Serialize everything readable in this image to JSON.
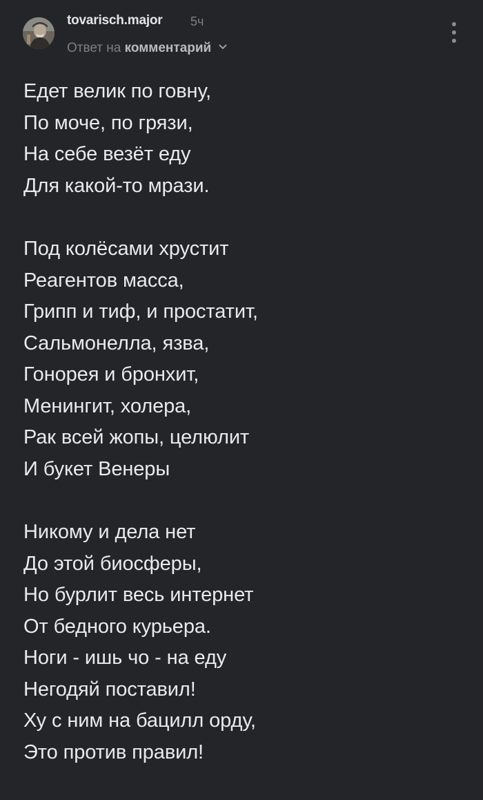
{
  "comment": {
    "author": "tovarisch.major",
    "time": "5ч",
    "reply_prefix": "Ответ на",
    "reply_link": "комментарий",
    "reply_icon": "chevron-down-icon",
    "menu_icon": "more-vertical-icon",
    "avatar_icon": "user-avatar"
  },
  "poem": {
    "stanzas": [
      {
        "lines": [
          "Едет велик по говну,",
          "По моче, по грязи,",
          "На себе везёт еду",
          "Для какой-то мрази."
        ]
      },
      {
        "lines": [
          "Под колёсами хрустит",
          "Реагентов масса,",
          "Грипп и тиф, и простатит,",
          "Сальмонелла, язва,",
          "Гонорея и бронхит,",
          "Менингит, холера,",
          "Рак всей жопы, целюлит",
          "И букет Венеры"
        ]
      },
      {
        "lines": [
          "Никому и дела нет",
          "До этой биосферы,",
          "Но бурлит весь интернет",
          "От бедного курьера.",
          "Ноги - ишь чо - на еду",
          "Негодяй поставил!",
          "Ху с ним на бацилл орду,",
          "Это против правил!"
        ]
      }
    ]
  },
  "colors": {
    "background": "#232528",
    "text": "#e9eaeb",
    "muted": "#7d8084"
  }
}
